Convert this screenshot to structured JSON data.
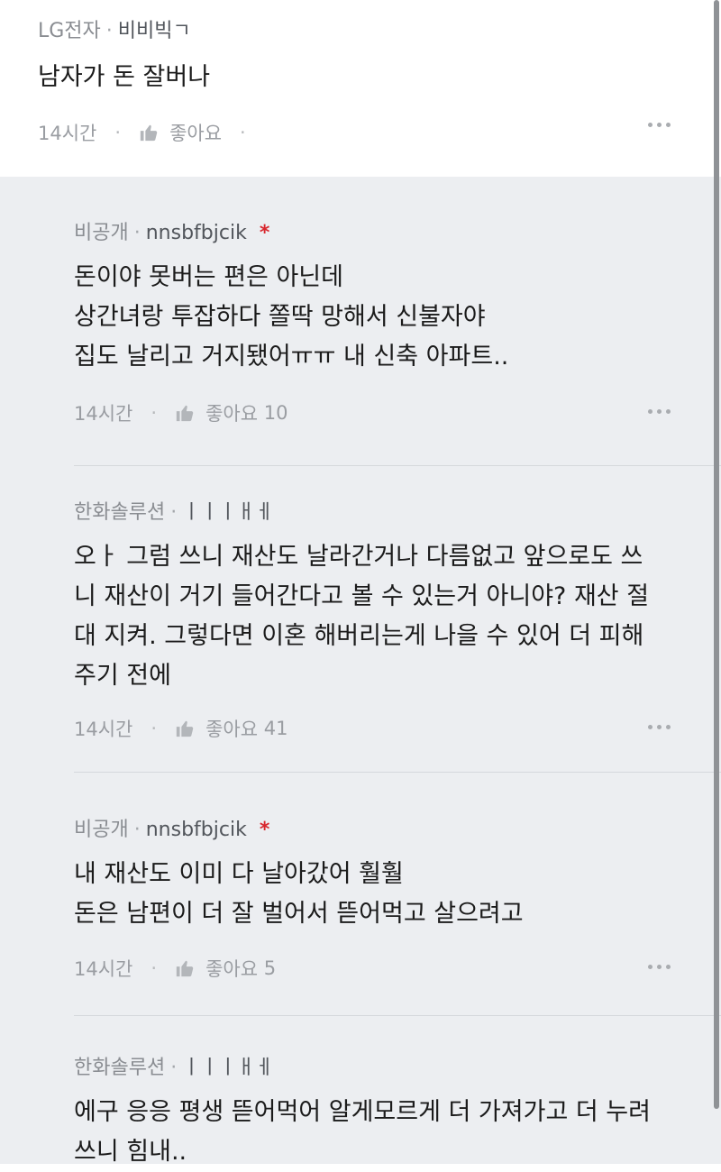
{
  "post": {
    "company": "LG전자",
    "separator": "·",
    "nickname": "비비빅ㄱ",
    "text": "남자가 돈 잘버나",
    "time": "14시간",
    "like_label": "좋아요",
    "like_count": ""
  },
  "replies": [
    {
      "company": "비공개",
      "nickname": "nnsbfbjcik",
      "author_mark": "*",
      "lines": [
        "돈이야 못버는 편은 아닌데",
        "상간녀랑 투잡하다 쫄딱 망해서 신불자야",
        "집도 날리고 거지됐어ㅠㅠ 내 신축 아파트.."
      ],
      "time": "14시간",
      "like_label": "좋아요",
      "like_count": "10"
    },
    {
      "company": "한화솔루션",
      "nickname": "ㅣㅣㅣㅐㅔ",
      "author_mark": "",
      "lines": [
        "오ㅏ 그럼 쓰니 재산도 날라간거나 다름없고 앞으로도 쓰",
        "니 재산이 거기 들어간다고 볼 수 있는거 아니야? 재산 절",
        "대 지켜. 그렇다면 이혼 해버리는게 나을 수 있어 더 피해",
        "주기 전에"
      ],
      "time": "14시간",
      "like_label": "좋아요",
      "like_count": "41"
    },
    {
      "company": "비공개",
      "nickname": "nnsbfbjcik",
      "author_mark": "*",
      "lines": [
        "내 재산도 이미 다 날아갔어 훨훨",
        "돈은 남편이 더 잘 벌어서 뜯어먹고 살으려고"
      ],
      "time": "14시간",
      "like_label": "좋아요",
      "like_count": "5"
    },
    {
      "company": "한화솔루션",
      "nickname": "ㅣㅣㅣㅐㅔ",
      "author_mark": "",
      "lines": [
        "에구 응응 평생 뜯어먹어 알게모르게 더 가져가고 더 누려",
        "쓰니 힘내.."
      ],
      "time": "",
      "like_label": "",
      "like_count": ""
    }
  ],
  "icons": {
    "like": "thumbs-up-icon",
    "more": "more-dots-icon"
  },
  "colors": {
    "reply_background": "#eceef1",
    "author_mark": "#d8262d"
  }
}
